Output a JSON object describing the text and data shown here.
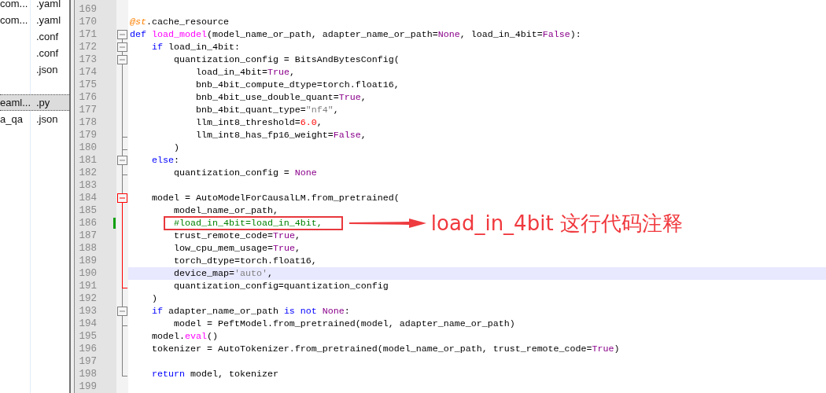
{
  "file_list": [
    {
      "name": "com...",
      "ext": ".yaml",
      "selected": false
    },
    {
      "name": "com...",
      "ext": ".yaml",
      "selected": false
    },
    {
      "ext": ".conf",
      "selected": false
    },
    {
      "ext": ".conf",
      "selected": false
    },
    {
      "ext": ".json",
      "selected": false
    },
    {
      "selected": false
    },
    {
      "name": "eaml...",
      "ext": ".py",
      "selected": true
    },
    {
      "name": "a_qa",
      "ext": ".json",
      "selected": false
    }
  ],
  "editor": {
    "lines": [
      {
        "number": "169",
        "changed": false,
        "current": false
      },
      {
        "number": "170",
        "changed": false,
        "current": false,
        "tokens": [
          {
            "text": "@st",
            "kind": "decorator"
          },
          {
            "text": ".cache_resource",
            "kind": "plain"
          }
        ]
      },
      {
        "number": "171",
        "fold": {
          "kind": "box",
          "highlight": false
        },
        "changed": false,
        "current": false,
        "tokens": [
          {
            "text": "def ",
            "kind": "keyword"
          },
          {
            "text": "load_model",
            "kind": "func"
          },
          {
            "text": "(model_name_or_path, adapter_name_or_path=",
            "kind": "plain"
          },
          {
            "text": "None",
            "kind": "const"
          },
          {
            "text": ", load_in_4bit=",
            "kind": "plain"
          },
          {
            "text": "False",
            "kind": "const"
          },
          {
            "text": "):",
            "kind": "plain"
          }
        ]
      },
      {
        "number": "172",
        "fold": {
          "kind": "box",
          "highlight": false
        },
        "changed": false,
        "current": false,
        "tokens": [
          {
            "text": "    if",
            "kind": "keyword"
          },
          {
            "text": " load_in_4bit:",
            "kind": "plain"
          }
        ]
      },
      {
        "number": "173",
        "fold": {
          "kind": "box",
          "highlight": false
        },
        "changed": false,
        "current": false,
        "tokens": [
          {
            "text": "        quantization_config = BitsAndBytesConfig(",
            "kind": "plain"
          }
        ]
      },
      {
        "number": "174",
        "fold": {
          "kind": "bar",
          "highlight": false
        },
        "changed": false,
        "current": false,
        "tokens": [
          {
            "text": "            load_in_4bit=",
            "kind": "plain"
          },
          {
            "text": "True",
            "kind": "const"
          },
          {
            "text": ",",
            "kind": "plain"
          }
        ]
      },
      {
        "number": "175",
        "fold": {
          "kind": "bar",
          "highlight": false
        },
        "changed": false,
        "current": false,
        "tokens": [
          {
            "text": "            bnb_4bit_compute_dtype=torch.float16,",
            "kind": "plain"
          }
        ]
      },
      {
        "number": "176",
        "fold": {
          "kind": "bar",
          "highlight": false
        },
        "changed": false,
        "current": false,
        "tokens": [
          {
            "text": "            bnb_4bit_use_double_quant=",
            "kind": "plain"
          },
          {
            "text": "True",
            "kind": "const"
          },
          {
            "text": ",",
            "kind": "plain"
          }
        ]
      },
      {
        "number": "177",
        "fold": {
          "kind": "bar",
          "highlight": false
        },
        "changed": false,
        "current": false,
        "tokens": [
          {
            "text": "            bnb_4bit_quant_type=",
            "kind": "plain"
          },
          {
            "text": "\"nf4\"",
            "kind": "string"
          },
          {
            "text": ",",
            "kind": "plain"
          }
        ]
      },
      {
        "number": "178",
        "fold": {
          "kind": "bar",
          "highlight": false
        },
        "changed": false,
        "current": false,
        "tokens": [
          {
            "text": "            llm_int8_threshold=",
            "kind": "plain"
          },
          {
            "text": "6.0",
            "kind": "number"
          },
          {
            "text": ",",
            "kind": "plain"
          }
        ]
      },
      {
        "number": "179",
        "fold": {
          "kind": "end",
          "highlight": false
        },
        "changed": false,
        "current": false,
        "tokens": [
          {
            "text": "            llm_int8_has_fp16_weight=",
            "kind": "plain"
          },
          {
            "text": "False",
            "kind": "const"
          },
          {
            "text": ",",
            "kind": "plain"
          }
        ]
      },
      {
        "number": "180",
        "fold": {
          "kind": "end",
          "highlight": false
        },
        "changed": false,
        "current": false,
        "tokens": [
          {
            "text": "        )",
            "kind": "plain"
          }
        ]
      },
      {
        "number": "181",
        "fold": {
          "kind": "box",
          "highlight": false
        },
        "changed": false,
        "current": false,
        "tokens": [
          {
            "text": "    else",
            "kind": "keyword"
          },
          {
            "text": ":",
            "kind": "plain"
          }
        ]
      },
      {
        "number": "182",
        "fold": {
          "kind": "end",
          "highlight": false
        },
        "changed": false,
        "current": false,
        "tokens": [
          {
            "text": "        quantization_config = ",
            "kind": "plain"
          },
          {
            "text": "None",
            "kind": "const"
          }
        ]
      },
      {
        "number": "183",
        "fold": {
          "kind": "bar",
          "highlight": false
        },
        "changed": false,
        "current": false
      },
      {
        "number": "184",
        "fold": {
          "kind": "box",
          "highlight": true
        },
        "changed": false,
        "current": false,
        "tokens": [
          {
            "text": "    model = AutoModelForCausalLM.from_pretrained(",
            "kind": "plain"
          }
        ]
      },
      {
        "number": "185",
        "fold": {
          "kind": "bar",
          "highlight": true
        },
        "changed": false,
        "current": false,
        "tokens": [
          {
            "text": "        model_name_or_path,",
            "kind": "plain"
          }
        ]
      },
      {
        "number": "186",
        "fold": {
          "kind": "bar",
          "highlight": true
        },
        "changed": true,
        "current": false,
        "tokens": [
          {
            "text": "        #load_in_4bit=load_in_4bit,",
            "kind": "comment"
          }
        ],
        "callout": "load_in_4bit 这行代码注释"
      },
      {
        "number": "187",
        "fold": {
          "kind": "bar",
          "highlight": true
        },
        "changed": false,
        "current": false,
        "tokens": [
          {
            "text": "        trust_remote_code=",
            "kind": "plain"
          },
          {
            "text": "True",
            "kind": "const"
          },
          {
            "text": ",",
            "kind": "plain"
          }
        ]
      },
      {
        "number": "188",
        "fold": {
          "kind": "bar",
          "highlight": true
        },
        "changed": false,
        "current": false,
        "tokens": [
          {
            "text": "        low_cpu_mem_usage=",
            "kind": "plain"
          },
          {
            "text": "True",
            "kind": "const"
          },
          {
            "text": ",",
            "kind": "plain"
          }
        ]
      },
      {
        "number": "189",
        "fold": {
          "kind": "bar",
          "highlight": true
        },
        "changed": false,
        "current": false,
        "tokens": [
          {
            "text": "        torch_dtype=torch.float16,",
            "kind": "plain"
          }
        ]
      },
      {
        "number": "190",
        "fold": {
          "kind": "bar",
          "highlight": true
        },
        "changed": false,
        "current": true,
        "tokens": [
          {
            "text": "        device_map=",
            "kind": "plain"
          },
          {
            "text": "'auto'",
            "kind": "string"
          },
          {
            "text": ",",
            "kind": "plain"
          }
        ]
      },
      {
        "number": "191",
        "fold": {
          "kind": "end",
          "highlight": true
        },
        "changed": false,
        "current": false,
        "tokens": [
          {
            "text": "        quantization_config=quantization_config",
            "kind": "plain"
          }
        ]
      },
      {
        "number": "192",
        "fold": {
          "kind": "bar",
          "highlight": false
        },
        "changed": false,
        "current": false,
        "tokens": [
          {
            "text": "    )",
            "kind": "plain"
          }
        ]
      },
      {
        "number": "193",
        "fold": {
          "kind": "box",
          "highlight": false
        },
        "changed": false,
        "current": false,
        "tokens": [
          {
            "text": "    if",
            "kind": "keyword"
          },
          {
            "text": " adapter_name_or_path ",
            "kind": "plain"
          },
          {
            "text": "is not",
            "kind": "keyword"
          },
          {
            "text": " None",
            "kind": "const"
          },
          {
            "text": ":",
            "kind": "plain"
          }
        ]
      },
      {
        "number": "194",
        "fold": {
          "kind": "end",
          "highlight": false
        },
        "changed": false,
        "current": false,
        "tokens": [
          {
            "text": "        model = PeftModel.from_pretrained(model, adapter_name_or_path)",
            "kind": "plain"
          }
        ]
      },
      {
        "number": "195",
        "fold": {
          "kind": "bar",
          "highlight": false
        },
        "changed": false,
        "current": false,
        "tokens": [
          {
            "text": "    model.",
            "kind": "plain"
          },
          {
            "text": "eval",
            "kind": "func"
          },
          {
            "text": "()",
            "kind": "plain"
          }
        ]
      },
      {
        "number": "196",
        "fold": {
          "kind": "bar",
          "highlight": false
        },
        "changed": false,
        "current": false,
        "tokens": [
          {
            "text": "    tokenizer = AutoTokenizer.from_pretrained(model_name_or_path, trust_remote_code=",
            "kind": "plain"
          },
          {
            "text": "True",
            "kind": "const"
          },
          {
            "text": ")",
            "kind": "plain"
          }
        ]
      },
      {
        "number": "197",
        "fold": {
          "kind": "bar",
          "highlight": false
        },
        "changed": false,
        "current": false
      },
      {
        "number": "198",
        "fold": {
          "kind": "end",
          "highlight": false
        },
        "changed": false,
        "current": false,
        "tokens": [
          {
            "text": "    return",
            "kind": "keyword"
          },
          {
            "text": " model, tokenizer",
            "kind": "plain"
          }
        ]
      },
      {
        "number": "199",
        "changed": false,
        "current": false
      }
    ]
  }
}
